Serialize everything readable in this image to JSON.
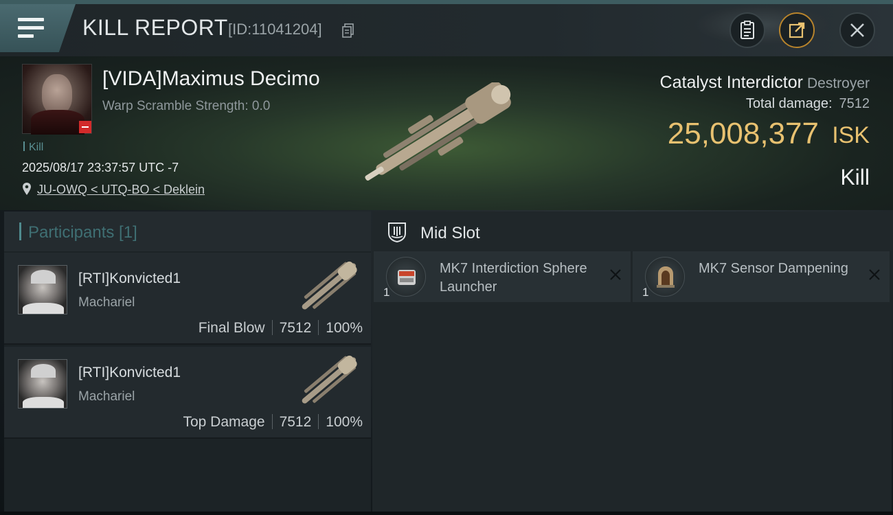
{
  "header": {
    "title": "KILL REPORT",
    "report_id": "[ID:11041204]",
    "menu_icon": "hamburger-menu-icon",
    "buttons": [
      "clipboard-icon",
      "share-icon",
      "close-icon"
    ],
    "accent_color": "#b8842c"
  },
  "victim": {
    "name": "[VIDA]Maximus Decimo",
    "warp_scramble": "Warp Scramble Strength: 0.0",
    "tag": "Kill",
    "datetime": "2025/08/17 23:37:57 UTC -7",
    "location": "JU-OWQ < UTQ-BO < Deklein",
    "ship_name": "Catalyst Interdictor",
    "ship_class": "Destroyer",
    "total_damage_label": "Total damage:",
    "total_damage": "7512",
    "isk_value": "25,008,377",
    "isk_unit": "ISK",
    "result": "Kill",
    "isk_color": "#e8c170"
  },
  "participants": {
    "title": "Participants [1]",
    "rows": [
      {
        "name": "[RTI]Konvicted1",
        "ship": "Machariel",
        "role": "Final Blow",
        "damage": "7512",
        "percent": "100%"
      },
      {
        "name": "[RTI]Konvicted1",
        "ship": "Machariel",
        "role": "Top Damage",
        "damage": "7512",
        "percent": "100%"
      }
    ]
  },
  "fitting": {
    "slot_title": "Mid Slot",
    "modules": [
      {
        "name": "MK7 Interdiction Sphere Launcher",
        "qty": "1",
        "icon": "interdiction-launcher-icon"
      },
      {
        "name": "MK7 Sensor Dampening",
        "qty": "1",
        "icon": "sensor-dampener-icon"
      }
    ]
  }
}
